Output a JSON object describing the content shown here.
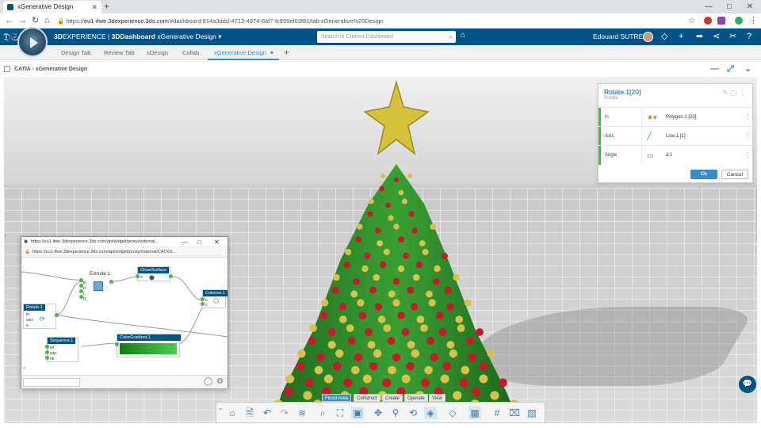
{
  "browser": {
    "tab_title": "xGenerative Design",
    "new_tab": "+",
    "url_prefix": "https://",
    "url_host": "eu1-ifwe.3dexperience.3ds.com",
    "url_path": "/#dashboard:814a3ddd-4713-4974-8af7-fc999ef03f81/tab:xGenerative%20Design",
    "win_min": "—",
    "win_max": "□",
    "win_close": "✕"
  },
  "ds_bar": {
    "brand_bold": "3D",
    "brand_rest": "EXPERIENCE | ",
    "app_bold": "3DDashboard",
    "dashboard_name": "xGenerative Design",
    "search_placeholder": "Search in Current Dashboard",
    "user_name": "Edouard SUTRE"
  },
  "dashboard_tabs": [
    "Design Tab",
    "Review Tab",
    "xDesign",
    "Collab",
    "xGenerative Design"
  ],
  "add_tab": "+",
  "widget": {
    "title": "CATIA - xGenerative Design"
  },
  "panel": {
    "title": "Rotate.1[20]",
    "subtitle": "Rotate",
    "rows": [
      {
        "label": "in",
        "value": "Polygon.1 [20]"
      },
      {
        "label": "Axis",
        "value": "Line.1 [1]"
      },
      {
        "label": "Angle",
        "value": "à.1"
      }
    ],
    "ok": "Ok",
    "cancel": "Cancel"
  },
  "popup": {
    "title": "https://eu1-ifwe.3dexperience.3ds.com/api/widget/proxy/external...",
    "url": "https://eu1-ifwe.3dexperience.3ds.com/api/widget/proxy/external/CATXG...",
    "nodes": {
      "extrude": "Extrude.1",
      "close_surface": "CloseSurface",
      "colorize": "Colorize.1",
      "rotate": "Rotate.1",
      "sequence": "Sequence.1",
      "color_gradient": "ColorGradient.1"
    },
    "ports": {
      "extrude": [
        "in",
        "d",
        "r",
        "f2"
      ],
      "close": "s",
      "colorize": [
        "o",
        "c"
      ],
      "rotate": [
        "in",
        "axis",
        "a"
      ],
      "sequence": [
        "inf",
        "sup",
        "nb"
      ]
    }
  },
  "toolbar_tabs": [
    "Flood Area",
    "Construct",
    "Create",
    "Operate",
    "View"
  ],
  "toolbar_active": "Flood Area",
  "colors": {
    "brand_blue": "#005386",
    "accent": "#368ec4",
    "port_green": "#4cb549",
    "tree_green": "#2f8a2a",
    "star_gold": "#d8c13c"
  }
}
